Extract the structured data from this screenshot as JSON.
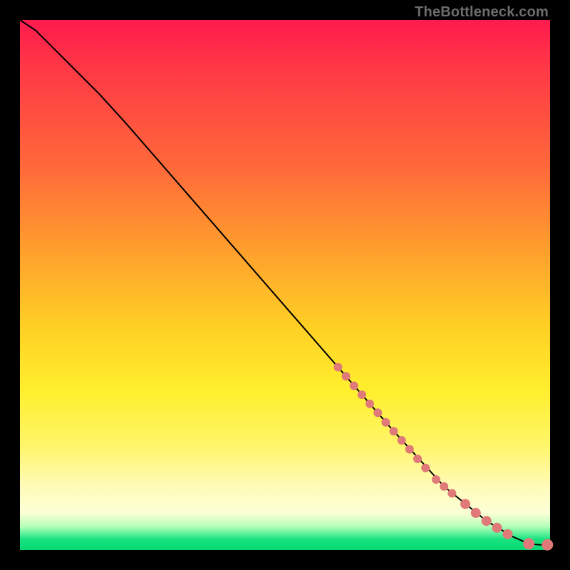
{
  "source_label": "TheBottleneck.com",
  "colors": {
    "dot": "#e07a78",
    "line": "#000000"
  },
  "chart_data": {
    "type": "line",
    "title": "",
    "xlabel": "",
    "ylabel": "",
    "xlim": [
      0,
      100
    ],
    "ylim": [
      0,
      100
    ],
    "grid": false,
    "legend": false,
    "series": [
      {
        "name": "curve",
        "kind": "line",
        "x": [
          0,
          3,
          6,
          10,
          15,
          20,
          30,
          40,
          50,
          60,
          70,
          80,
          88,
          93,
          96,
          98,
          100
        ],
        "y": [
          100,
          98,
          95,
          91,
          86,
          80.5,
          69,
          57.5,
          46,
          34.5,
          23,
          12,
          5.5,
          2.5,
          1.2,
          1.0,
          1.0
        ]
      },
      {
        "name": "points",
        "kind": "scatter",
        "points": [
          {
            "x": 60.0,
            "y": 34.5,
            "r": 6
          },
          {
            "x": 61.5,
            "y": 32.8,
            "r": 6
          },
          {
            "x": 63.0,
            "y": 31.0,
            "r": 6
          },
          {
            "x": 64.5,
            "y": 29.3,
            "r": 6
          },
          {
            "x": 66.0,
            "y": 27.6,
            "r": 6
          },
          {
            "x": 67.5,
            "y": 25.9,
            "r": 6
          },
          {
            "x": 69.0,
            "y": 24.1,
            "r": 6
          },
          {
            "x": 70.5,
            "y": 22.4,
            "r": 6
          },
          {
            "x": 72.0,
            "y": 20.7,
            "r": 6
          },
          {
            "x": 73.5,
            "y": 19.0,
            "r": 6
          },
          {
            "x": 75.0,
            "y": 17.2,
            "r": 6
          },
          {
            "x": 76.5,
            "y": 15.5,
            "r": 6
          },
          {
            "x": 78.5,
            "y": 13.3,
            "r": 6
          },
          {
            "x": 80.0,
            "y": 12.0,
            "r": 6
          },
          {
            "x": 81.5,
            "y": 10.7,
            "r": 6
          },
          {
            "x": 84.0,
            "y": 8.7,
            "r": 7
          },
          {
            "x": 86.0,
            "y": 7.0,
            "r": 7
          },
          {
            "x": 88.0,
            "y": 5.5,
            "r": 7
          },
          {
            "x": 90.0,
            "y": 4.2,
            "r": 7
          },
          {
            "x": 92.0,
            "y": 3.0,
            "r": 7
          },
          {
            "x": 96.0,
            "y": 1.2,
            "r": 8
          },
          {
            "x": 99.5,
            "y": 1.0,
            "r": 8
          }
        ]
      }
    ]
  }
}
